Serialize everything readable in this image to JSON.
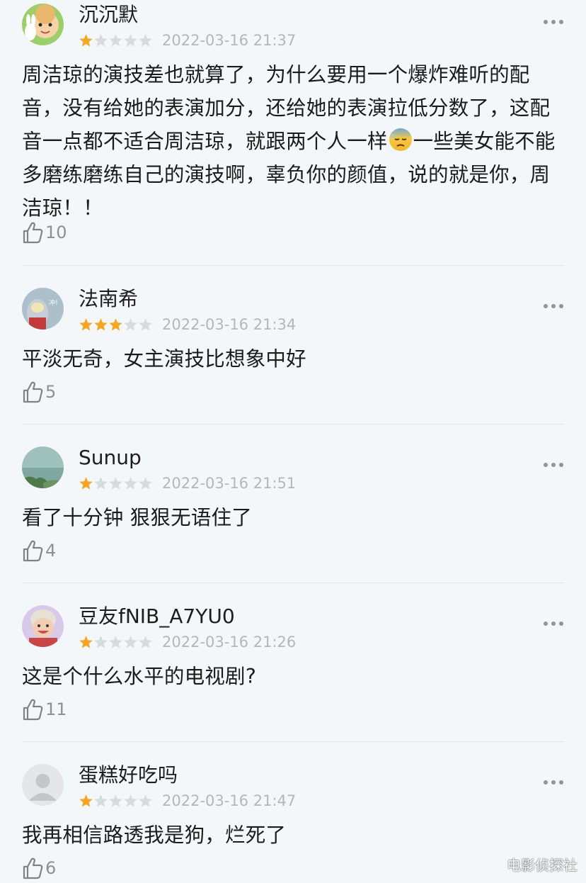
{
  "colors": {
    "background": "#f4f7f9",
    "star_filled": "#f5a623",
    "star_empty": "#d8dbde",
    "timestamp": "#b3b7bb",
    "like_count": "#8c9196",
    "divider": "#e1e4e7"
  },
  "comments": [
    {
      "username": "沉沉默",
      "avatar": "avatar-cartoon-baby",
      "rating": 1,
      "max_rating": 5,
      "timestamp": "2022-03-16 21:37",
      "text_before_emoji": "周洁琼的演技差也就算了，为什么要用一个爆炸难听的配音，没有给她的表演加分，还给她的表演拉低分数了，这配音一点都不适合周洁琼，就跟两个人一样",
      "emoji": "downcast-face-with-sweat",
      "text_after_emoji": "一些美女能不能多磨练磨练自己的演技啊，辜负你的颜值，说的就是你，周洁琼！！",
      "likes": "10"
    },
    {
      "username": "法南希",
      "avatar": "avatar-ultraman",
      "rating": 3,
      "max_rating": 5,
      "timestamp": "2022-03-16 21:34",
      "text": "平淡无奇，女主演技比想象中好",
      "likes": "5"
    },
    {
      "username": "Sunup",
      "avatar": "avatar-landscape",
      "rating": 1,
      "max_rating": 5,
      "timestamp": "2022-03-16 21:51",
      "text": "看了十分钟 狠狠无语住了",
      "likes": "4"
    },
    {
      "username": "豆友fNIB_A7YU0",
      "avatar": "avatar-child-photo",
      "rating": 1,
      "max_rating": 5,
      "timestamp": "2022-03-16 21:26",
      "text": "这是个什么水平的电视剧?",
      "likes": "11"
    },
    {
      "username": "蛋糕好吃吗",
      "avatar": "avatar-default",
      "rating": 1,
      "max_rating": 5,
      "timestamp": "2022-03-16 21:47",
      "text": "我再相信路透我是狗，烂死了",
      "likes": "6"
    }
  ],
  "icons": {
    "more": "more-dots-icon",
    "like": "thumbs-up-icon",
    "star": "star-icon"
  },
  "watermark": "电影侦探社"
}
